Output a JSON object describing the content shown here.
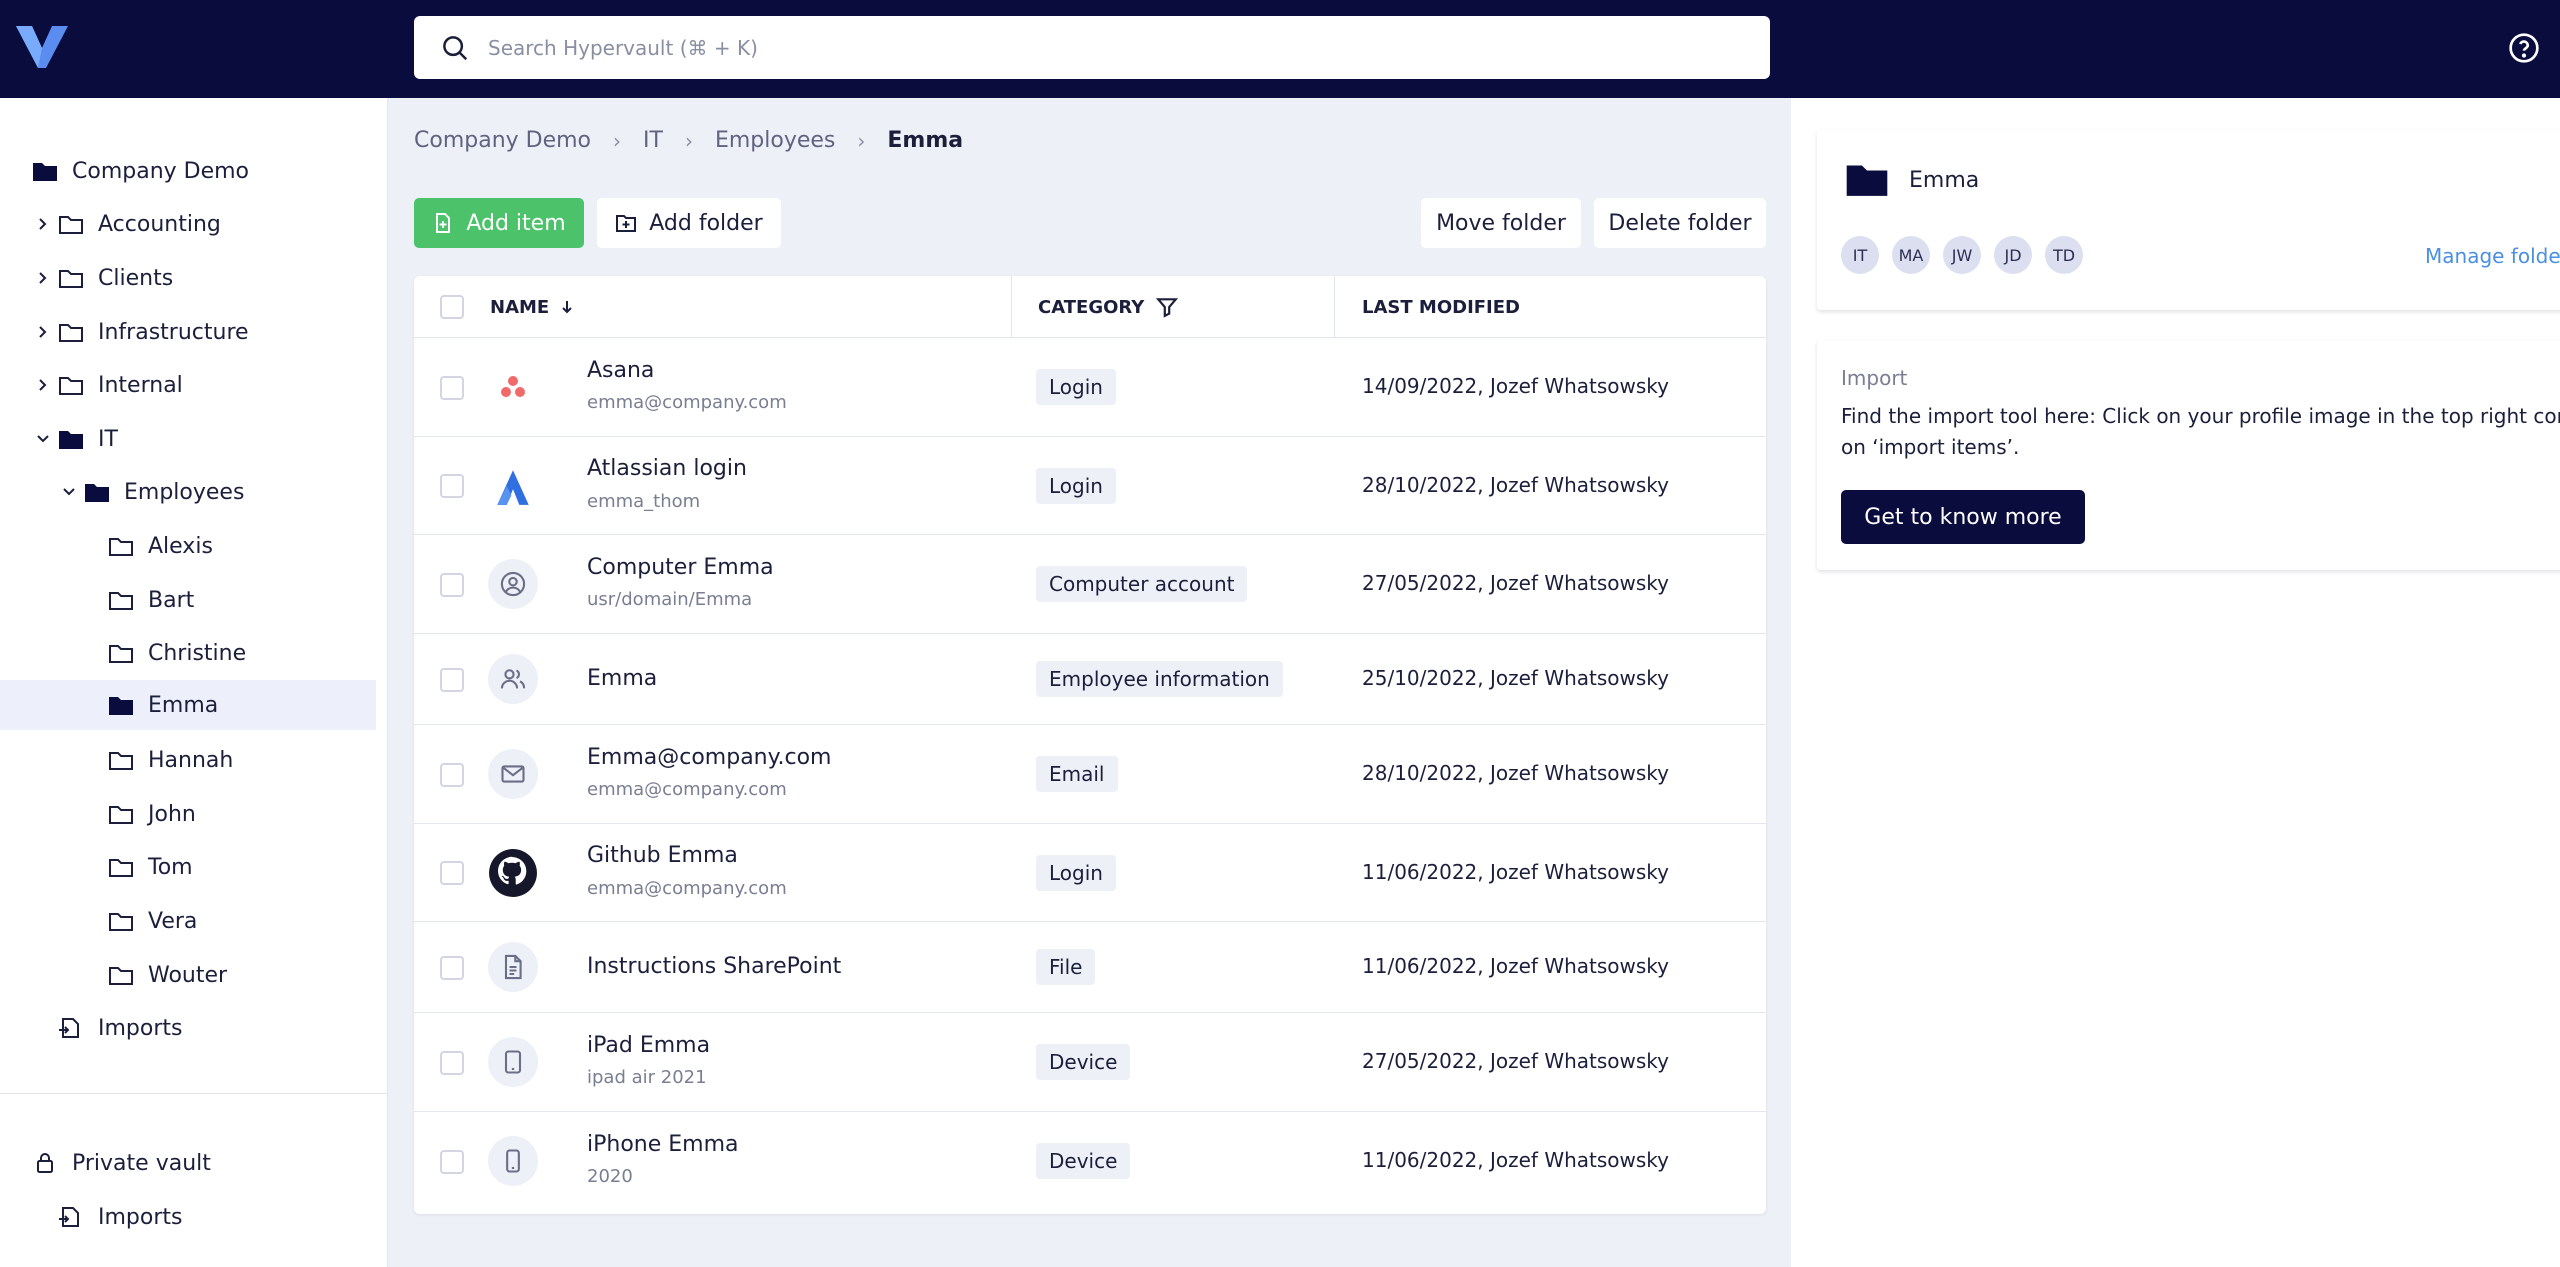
{
  "header": {
    "search_placeholder": "Search Hypervault (⌘ + K)"
  },
  "sidebar": {
    "root": "Company Demo",
    "items": [
      {
        "label": "Accounting"
      },
      {
        "label": "Clients"
      },
      {
        "label": "Infrastructure"
      },
      {
        "label": "Internal"
      },
      {
        "label": "IT"
      },
      {
        "label": "Employees"
      },
      {
        "label": "Alexis"
      },
      {
        "label": "Bart"
      },
      {
        "label": "Christine"
      },
      {
        "label": "Emma"
      },
      {
        "label": "Hannah"
      },
      {
        "label": "John"
      },
      {
        "label": "Tom"
      },
      {
        "label": "Vera"
      },
      {
        "label": "Wouter"
      },
      {
        "label": "Imports"
      }
    ],
    "private_vault": "Private vault",
    "private_imports": "Imports"
  },
  "breadcrumb": [
    "Company Demo",
    "IT",
    "Employees",
    "Emma"
  ],
  "toolbar": {
    "add_item": "Add item",
    "add_folder": "Add folder",
    "move_folder": "Move folder",
    "delete_folder": "Delete folder"
  },
  "table": {
    "columns": [
      "NAME",
      "CATEGORY",
      "LAST MODIFIED"
    ],
    "rows": [
      {
        "title": "Asana",
        "sub": "emma@company.com",
        "category": "Login",
        "modified": "14/09/2022, Jozef Whatsowsky",
        "icon": "asana-icon"
      },
      {
        "title": "Atlassian login",
        "sub": "emma_thom",
        "category": "Login",
        "modified": "28/10/2022, Jozef Whatsowsky",
        "icon": "atlassian-icon"
      },
      {
        "title": "Computer Emma",
        "sub": "usr/domain/Emma",
        "category": "Computer account",
        "modified": "27/05/2022, Jozef Whatsowsky",
        "icon": "user-circle-icon"
      },
      {
        "title": "Emma",
        "sub": "",
        "category": "Employee information",
        "modified": "25/10/2022, Jozef Whatsowsky",
        "icon": "users-icon"
      },
      {
        "title": "Emma@company.com",
        "sub": "emma@company.com",
        "category": "Email",
        "modified": "28/10/2022, Jozef Whatsowsky",
        "icon": "mail-icon"
      },
      {
        "title": "Github Emma",
        "sub": "emma@company.com",
        "category": "Login",
        "modified": "11/06/2022, Jozef Whatsowsky",
        "icon": "github-icon"
      },
      {
        "title": "Instructions SharePoint",
        "sub": "",
        "category": "File",
        "modified": "11/06/2022, Jozef Whatsowsky",
        "icon": "file-icon"
      },
      {
        "title": "iPad Emma",
        "sub": "ipad air 2021",
        "category": "Device",
        "modified": "27/05/2022, Jozef Whatsowsky",
        "icon": "tablet-icon"
      },
      {
        "title": "iPhone Emma",
        "sub": "2020",
        "category": "Device",
        "modified": "11/06/2022, Jozef Whatsowsky",
        "icon": "phone-icon"
      }
    ]
  },
  "folder_card": {
    "title": "Emma",
    "avatars": [
      "IT",
      "MA",
      "JW",
      "JD",
      "TD"
    ],
    "manage_link": "Manage folde"
  },
  "import_card": {
    "heading": "Import",
    "text_line1": "Find the import tool here: Click on your profile image in the top right corne",
    "text_line2": "on ‘import items’.",
    "button": "Get to know more"
  },
  "colors": {
    "topbar": "#0a0c3d",
    "accent_green": "#4cc26b",
    "link_blue": "#4a8fe0"
  }
}
